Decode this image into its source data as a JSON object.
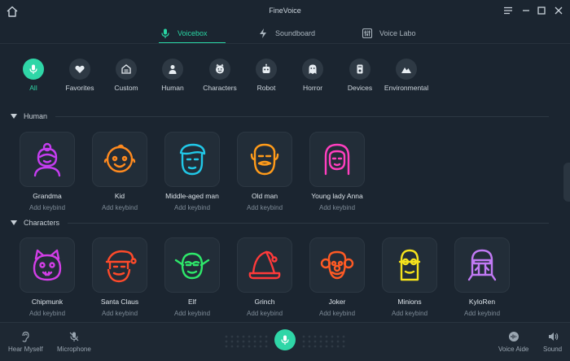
{
  "app": {
    "title": "FineVoice"
  },
  "tabs": [
    {
      "label": "Voicebox",
      "active": true,
      "icon": "mic-icon"
    },
    {
      "label": "Soundboard",
      "active": false,
      "icon": "lightning-icon"
    },
    {
      "label": "Voice Labo",
      "active": false,
      "icon": "equalizer-icon"
    }
  ],
  "categories": [
    {
      "label": "All",
      "icon": "mic-icon",
      "active": true
    },
    {
      "label": "Favorites",
      "icon": "heart-icon"
    },
    {
      "label": "Custom",
      "icon": "custom-icon"
    },
    {
      "label": "Human",
      "icon": "person-icon"
    },
    {
      "label": "Characters",
      "icon": "smiley-icon"
    },
    {
      "label": "Robot",
      "icon": "robot-icon"
    },
    {
      "label": "Horror",
      "icon": "ghost-icon"
    },
    {
      "label": "Devices",
      "icon": "device-icon"
    },
    {
      "label": "Environmental",
      "icon": "mountain-icon"
    }
  ],
  "sections": {
    "human": {
      "title": "Human",
      "voices": [
        {
          "name": "Grandma",
          "keybind": "Add keybind",
          "color": "#c53df0"
        },
        {
          "name": "Kid",
          "keybind": "Add keybind",
          "color": "#ff8a1f"
        },
        {
          "name": "Middle-aged man",
          "keybind": "Add keybind",
          "color": "#21c8e8"
        },
        {
          "name": "Old man",
          "keybind": "Add keybind",
          "color": "#ff9b1a"
        },
        {
          "name": "Young lady Anna",
          "keybind": "Add keybind",
          "color": "#ff3fbf"
        }
      ]
    },
    "characters": {
      "title": "Characters",
      "voices": [
        {
          "name": "Chipmunk",
          "keybind": "Add keybind",
          "color": "#d23ee6"
        },
        {
          "name": "Santa Claus",
          "keybind": "Add keybind",
          "color": "#ff4a2a"
        },
        {
          "name": "Elf",
          "keybind": "Add keybind",
          "color": "#2ee86a"
        },
        {
          "name": "Grinch",
          "keybind": "Add keybind",
          "color": "#ff3a3a"
        },
        {
          "name": "Joker",
          "keybind": "Add keybind",
          "color": "#ff5a24"
        },
        {
          "name": "Minions",
          "keybind": "Add keybind",
          "color": "#f5e21c"
        },
        {
          "name": "KyloRen",
          "keybind": "Add keybind",
          "color": "#c27af5"
        }
      ]
    }
  },
  "bottombar": {
    "hear_myself": "Hear Myself",
    "microphone": "Microphone",
    "voice_aide": "Voice Aide",
    "sound": "Sound"
  },
  "colors": {
    "accent": "#2fd6a7",
    "background": "#1b2530"
  }
}
